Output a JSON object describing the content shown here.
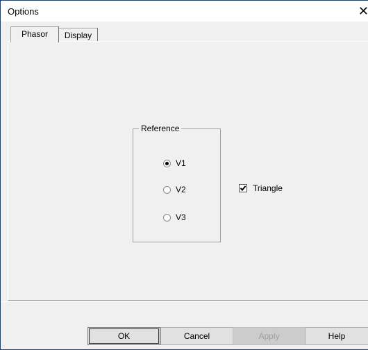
{
  "window": {
    "title": "Options",
    "close_glyph": "✕",
    "close_icon": "close-icon"
  },
  "tabs": [
    {
      "label": "Phasor",
      "active": true
    },
    {
      "label": "Display",
      "active": false
    }
  ],
  "phasor": {
    "reference_group_label": "Reference",
    "reference_options": [
      {
        "label": "V1",
        "selected": true
      },
      {
        "label": "V2",
        "selected": false
      },
      {
        "label": "V3",
        "selected": false
      }
    ],
    "triangle": {
      "label": "Triangle",
      "checked": true
    }
  },
  "buttons": {
    "ok": "OK",
    "cancel": "Cancel",
    "apply": "Apply",
    "help": "Help"
  }
}
